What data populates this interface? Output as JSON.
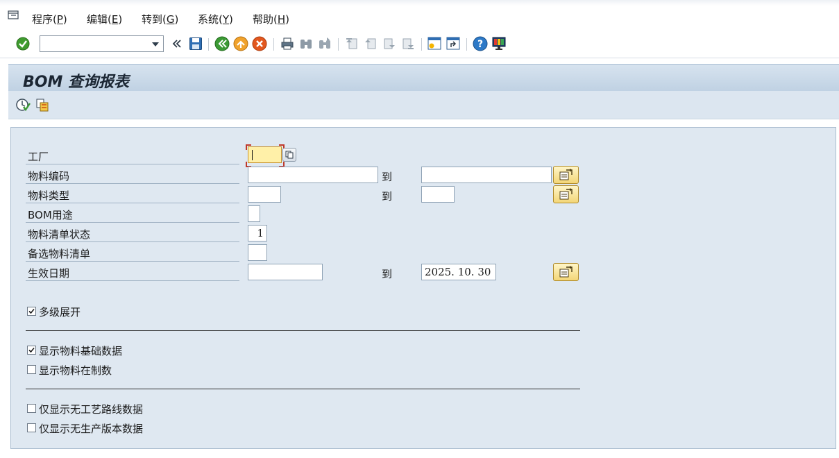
{
  "menu": {
    "items": [
      {
        "text": "程序(",
        "key": "P",
        "tail": ")"
      },
      {
        "text": "编辑(",
        "key": "E",
        "tail": ")"
      },
      {
        "text": "转到(",
        "key": "G",
        "tail": ")"
      },
      {
        "text": "系统(",
        "key": "Y",
        "tail": ")"
      },
      {
        "text": "帮助(",
        "key": "H",
        "tail": ")"
      }
    ]
  },
  "toolbar": {
    "command_value": "",
    "icons": [
      "enter-icon",
      "save-icon",
      "back-icon",
      "exit-icon",
      "cancel-icon",
      "print-icon",
      "find-icon",
      "find-next-icon",
      "first-page-icon",
      "prev-page-icon",
      "next-page-icon",
      "last-page-icon",
      "new-session-icon",
      "shortcut-icon",
      "help-icon",
      "customize-layout-icon"
    ]
  },
  "page": {
    "title": "BOM 查询报表"
  },
  "form": {
    "to_label": "到",
    "fields": [
      {
        "label": "工厂",
        "low": "",
        "high": null
      },
      {
        "label": "物料编码",
        "low": "",
        "high": ""
      },
      {
        "label": "物料类型",
        "low": "",
        "high": ""
      },
      {
        "label": "BOM用途",
        "low": "",
        "high": null
      },
      {
        "label": "物料清单状态",
        "low": "1",
        "high": null
      },
      {
        "label": "备选物料清单",
        "low": "",
        "high": null
      },
      {
        "label": "生效日期",
        "low": "",
        "high": "2025. 10. 30"
      }
    ],
    "checkboxes": [
      {
        "label": "多级展开",
        "checked": true
      },
      {
        "label": "显示物料基础数据",
        "checked": true
      },
      {
        "label": "显示物料在制数",
        "checked": false
      },
      {
        "label": "仅显示无工艺路线数据",
        "checked": false
      },
      {
        "label": "仅显示无生产版本数据",
        "checked": false
      }
    ]
  }
}
